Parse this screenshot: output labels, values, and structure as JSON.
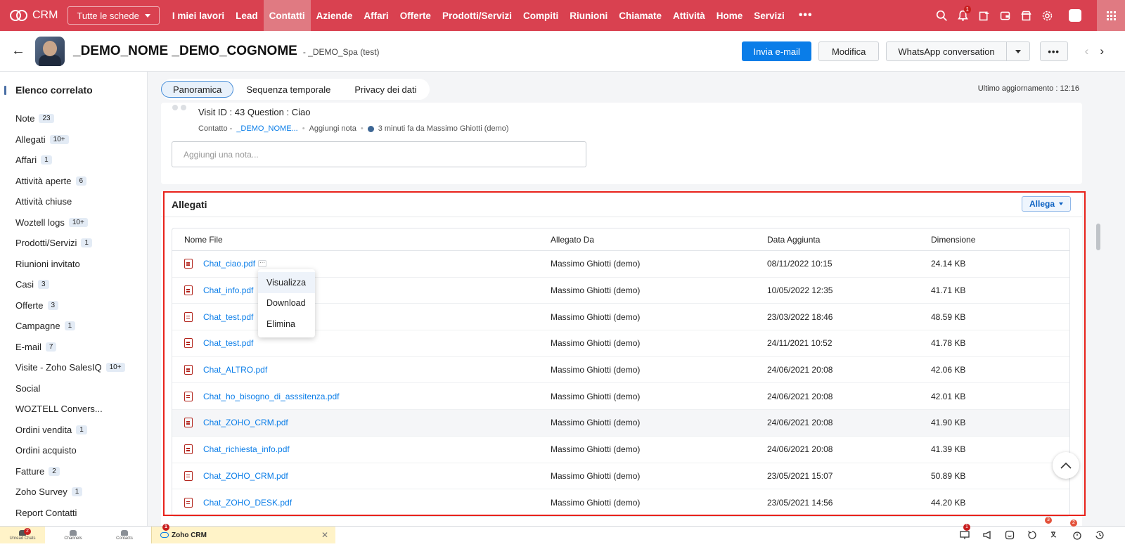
{
  "topnav": {
    "logo": "CRM",
    "tab_selector": "Tutte le schede",
    "items": [
      "I miei lavori",
      "Lead",
      "Contatti",
      "Aziende",
      "Affari",
      "Offerte",
      "Prodotti/Servizi",
      "Compiti",
      "Riunioni",
      "Chiamate",
      "Attività",
      "Home",
      "Servizi"
    ],
    "active": "Contatti",
    "more": "•••",
    "notifications_badge": "1",
    "accent_color": "#d94150"
  },
  "record": {
    "name": "_DEMO_NOME _DEMO_COGNOME",
    "company": "- _DEMO_Spa (test)",
    "btn_email": "Invia e-mail",
    "btn_edit": "Modifica",
    "btn_whatsapp": "WhatsApp conversation",
    "btn_more": "•••"
  },
  "sidebar": {
    "title": "Elenco correlato",
    "items": [
      {
        "label": "Note",
        "count": "23"
      },
      {
        "label": "Allegati",
        "count": "10+"
      },
      {
        "label": "Affari",
        "count": "1"
      },
      {
        "label": "Attività aperte",
        "count": "6"
      },
      {
        "label": "Attività chiuse",
        "count": ""
      },
      {
        "label": "Woztell logs",
        "count": "10+"
      },
      {
        "label": "Prodotti/Servizi",
        "count": "1"
      },
      {
        "label": "Riunioni invitato",
        "count": ""
      },
      {
        "label": "Casi",
        "count": "3"
      },
      {
        "label": "Offerte",
        "count": "3"
      },
      {
        "label": "Campagne",
        "count": "1"
      },
      {
        "label": "E-mail",
        "count": "7"
      },
      {
        "label": "Visite - Zoho SalesIQ",
        "count": "10+"
      },
      {
        "label": "Social",
        "count": ""
      },
      {
        "label": "WOZTELL Convers...",
        "count": ""
      },
      {
        "label": "Ordini vendita",
        "count": "1"
      },
      {
        "label": "Ordini acquisto",
        "count": ""
      },
      {
        "label": "Fatture",
        "count": "2"
      },
      {
        "label": "Zoho Survey",
        "count": "1"
      },
      {
        "label": "Report Contatti",
        "count": ""
      },
      {
        "label": "Zoho Projects",
        "count": ""
      }
    ]
  },
  "subtabs": [
    "Panoramica",
    "Sequenza temporale",
    "Privacy dei dati"
  ],
  "last_updated": "Ultimo aggiornamento : 12:16",
  "note": {
    "text": "Visit ID : 43 Question : Ciao",
    "meta_type": "Contatto -",
    "meta_link": "_DEMO_NOME...",
    "meta_add": "Aggiungi nota",
    "meta_time": "3 minuti fa  da  Massimo Ghiotti (demo)",
    "placeholder": "Aggiungi una nota..."
  },
  "attachments": {
    "title": "Allegati",
    "attach_btn": "Allega",
    "columns": [
      "Nome File",
      "Allegato Da",
      "Data Aggiunta",
      "Dimensione"
    ],
    "rows": [
      {
        "file": "Chat_ciao.pdf",
        "by": "Massimo Ghiotti (demo)",
        "date": "08/11/2022 10:15",
        "size": "24.14 KB"
      },
      {
        "file": "Chat_info.pdf",
        "by": "Massimo Ghiotti (demo)",
        "date": "10/05/2022 12:35",
        "size": "41.71 KB"
      },
      {
        "file": "Chat_test.pdf",
        "by": "Massimo Ghiotti (demo)",
        "date": "23/03/2022 18:46",
        "size": "48.59 KB"
      },
      {
        "file": "Chat_test.pdf",
        "by": "Massimo Ghiotti (demo)",
        "date": "24/11/2021 10:52",
        "size": "41.78 KB"
      },
      {
        "file": "Chat_ALTRO.pdf",
        "by": "Massimo Ghiotti (demo)",
        "date": "24/06/2021 20:08",
        "size": "42.06 KB"
      },
      {
        "file": "Chat_ho_bisogno_di_asssitenza.pdf",
        "by": "Massimo Ghiotti (demo)",
        "date": "24/06/2021 20:08",
        "size": "42.01 KB"
      },
      {
        "file": "Chat_ZOHO_CRM.pdf",
        "by": "Massimo Ghiotti (demo)",
        "date": "24/06/2021 20:08",
        "size": "41.90 KB"
      },
      {
        "file": "Chat_richiesta_info.pdf",
        "by": "Massimo Ghiotti (demo)",
        "date": "24/06/2021 20:08",
        "size": "41.39 KB"
      },
      {
        "file": "Chat_ZOHO_CRM.pdf",
        "by": "Massimo Ghiotti (demo)",
        "date": "23/05/2021 15:07",
        "size": "50.89 KB"
      },
      {
        "file": "Chat_ZOHO_DESK.pdf",
        "by": "Massimo Ghiotti (demo)",
        "date": "23/05/2021 14:56",
        "size": "44.20 KB"
      }
    ],
    "hover_row": 6
  },
  "context_menu": [
    "Visualizza",
    "Download",
    "Elimina"
  ],
  "bottombar": {
    "unread": "Unread Chats",
    "unread_badge": "2",
    "channels": "Channels",
    "contacts": "Contacts",
    "tab": "Zoho CRM",
    "tab_badge": "1",
    "badge_a": "1",
    "badge_b": "3",
    "badge_c": "2"
  }
}
